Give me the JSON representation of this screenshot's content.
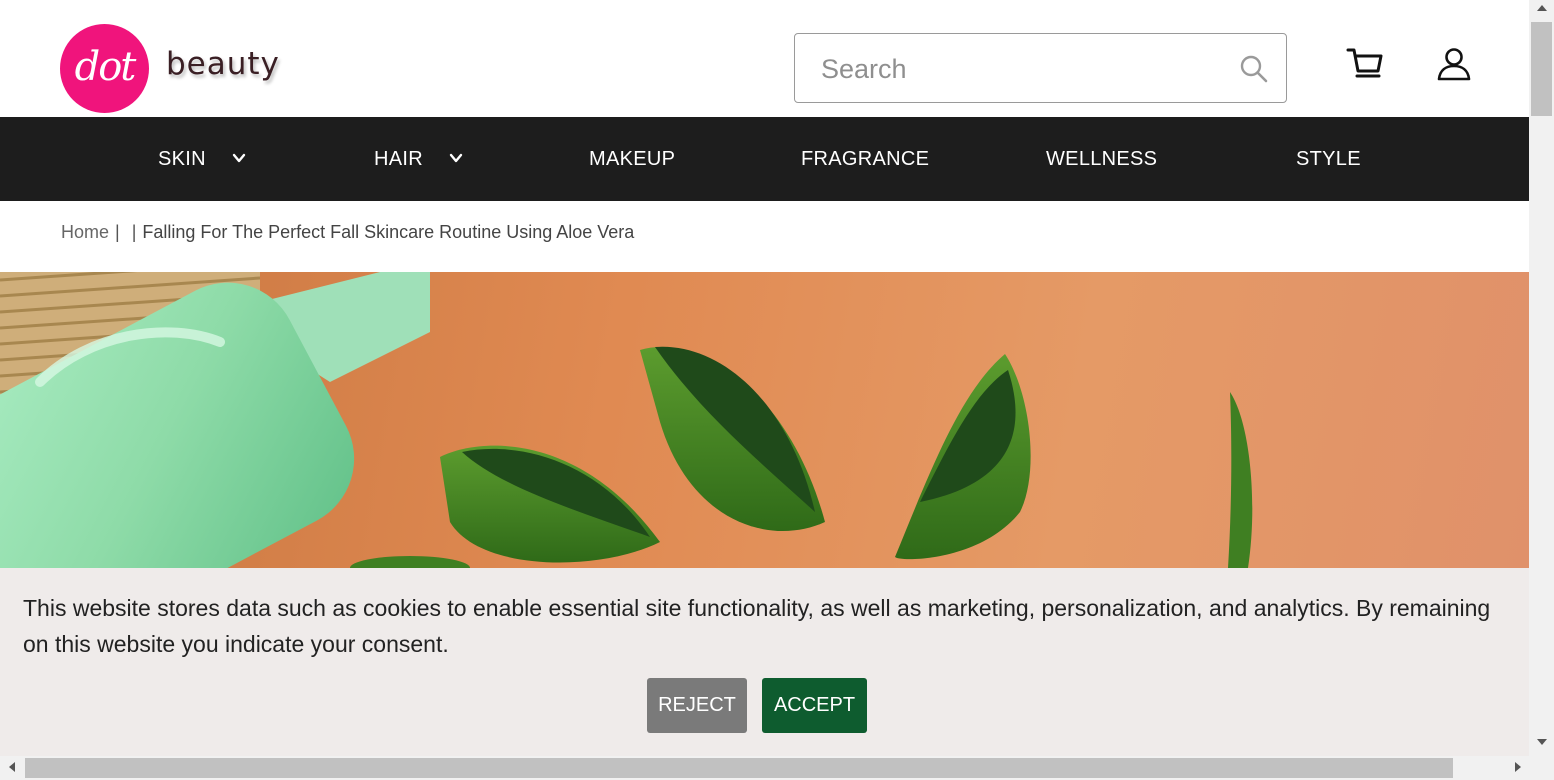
{
  "brand": {
    "mark": "dot",
    "name": "beauty",
    "mark_color": "#f0147c"
  },
  "search": {
    "placeholder": "Search",
    "icon": "search-icon"
  },
  "header_icons": [
    "cart-icon",
    "user-icon"
  ],
  "nav": {
    "items": [
      {
        "label": "SKIN",
        "has_dropdown": true
      },
      {
        "label": "HAIR",
        "has_dropdown": true
      },
      {
        "label": "MAKEUP",
        "has_dropdown": false
      },
      {
        "label": "FRAGRANCE",
        "has_dropdown": false
      },
      {
        "label": "WELLNESS",
        "has_dropdown": false
      },
      {
        "label": "STYLE",
        "has_dropdown": false
      }
    ],
    "background": "#1d1d1d"
  },
  "breadcrumb": {
    "home": "Home",
    "separator": "|",
    "current": "Falling For The Perfect Fall Skincare Routine Using Aloe Vera"
  },
  "hero": {
    "colors": {
      "board": "#e08a52",
      "bottle": "#8edba8",
      "aloe": "#3f7f22"
    }
  },
  "cookie": {
    "message": "This website stores data such as cookies to enable essential site functionality, as well as marketing, personalization, and analytics. By remaining on this website you indicate your consent.",
    "reject_label": "REJECT",
    "accept_label": "ACCEPT",
    "accept_color": "#0e5c2f",
    "reject_color": "#7a7a7a"
  }
}
